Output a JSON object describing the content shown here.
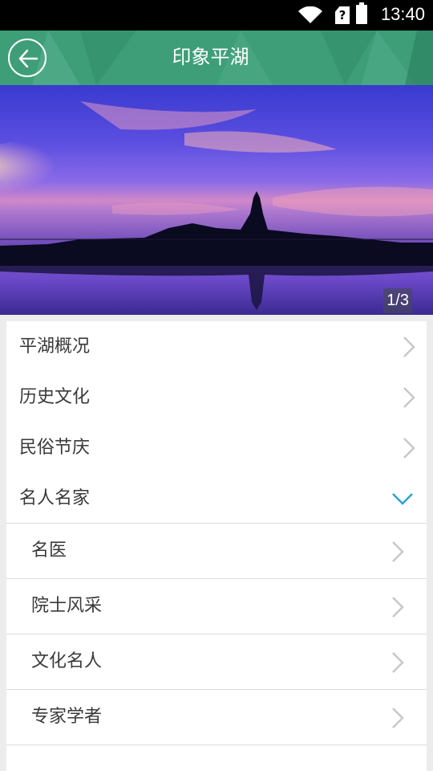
{
  "status_bar": {
    "time": "13:40",
    "sim_icon": "sim-unknown-icon",
    "wifi_icon": "wifi-icon",
    "battery_icon": "battery-icon"
  },
  "header": {
    "title": "印象平湖",
    "back_icon": "back-arrow-icon",
    "color": "#3d9e78"
  },
  "banner": {
    "counter": "1/3"
  },
  "menu": {
    "items": [
      {
        "label": "平湖概况"
      },
      {
        "label": "历史文化"
      },
      {
        "label": "民俗节庆"
      },
      {
        "label": "名人名家",
        "expanded": true
      }
    ],
    "subitems": [
      {
        "label": "名医"
      },
      {
        "label": "院士风采"
      },
      {
        "label": "文化名人"
      },
      {
        "label": "专家学者"
      }
    ]
  },
  "accent_color": "#2aa4d6"
}
